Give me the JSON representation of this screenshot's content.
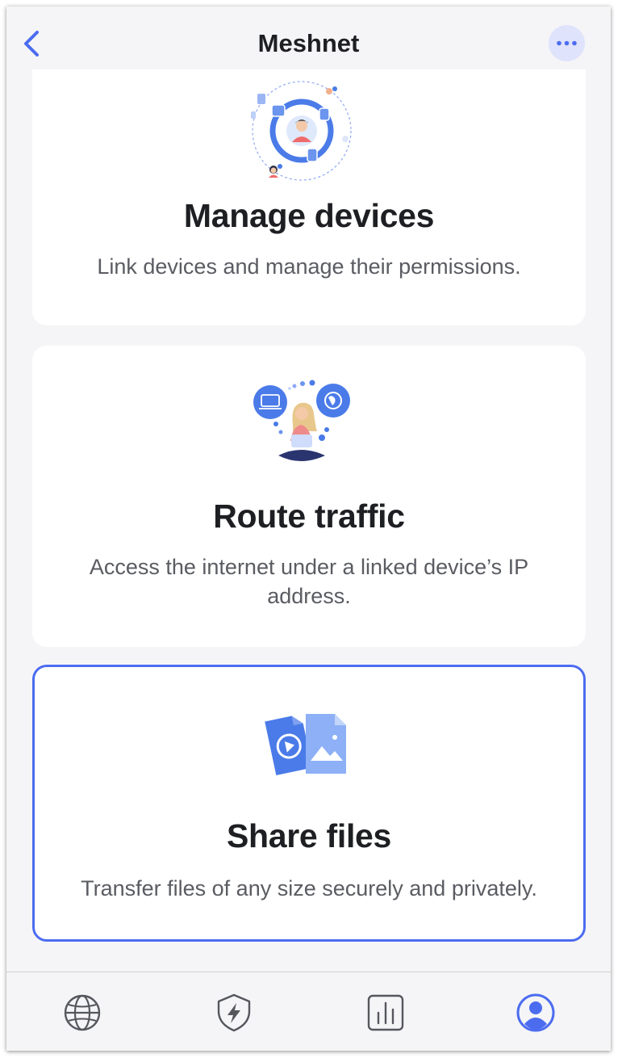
{
  "header": {
    "title": "Meshnet"
  },
  "cards": [
    {
      "title": "Manage devices",
      "description": "Link devices and manage their permissions."
    },
    {
      "title": "Route traffic",
      "description": "Access the internet under a linked device’s IP address."
    },
    {
      "title": "Share files",
      "description": "Transfer files of any size securely and privately."
    }
  ],
  "colors": {
    "accent": "#4c6cf0",
    "background": "#f5f5f7",
    "card": "#ffffff"
  },
  "icons": {
    "back": "chevron-left-icon",
    "more": "more-horizontal-icon",
    "tabs": [
      "globe-icon",
      "shield-bolt-icon",
      "bar-chart-icon",
      "profile-icon"
    ]
  },
  "selected_card": "Share files",
  "active_tab": "profile-icon"
}
